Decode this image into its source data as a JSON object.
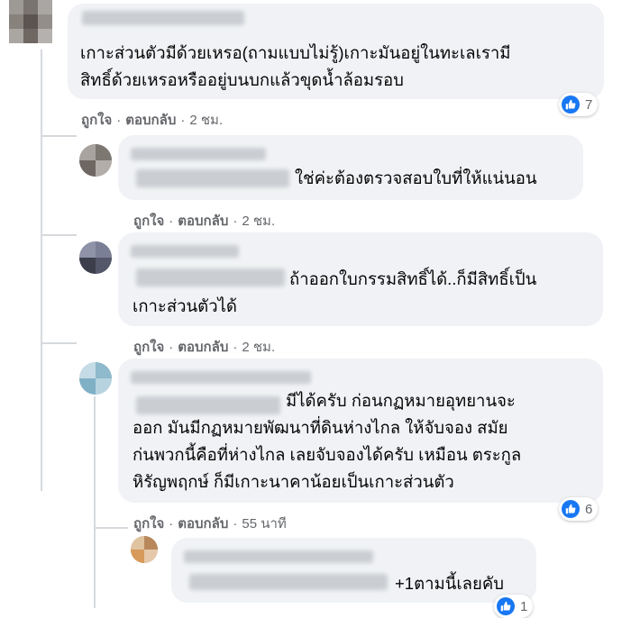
{
  "actions": {
    "like": "ถูกใจ",
    "dot": "·",
    "reply": "ตอบกลับ"
  },
  "comments": [
    {
      "lines": [
        "เกาะส่วนตัวมีด้วยเหรอ(ถามแบบไม่รู้)เกาะมันอยู่ในทะเลเรามี",
        "สิทธิ์ด้วยเหรอหรืออยู่บนบกแล้วขุดน้ำล้อมรอบ"
      ],
      "time": "2 ชม.",
      "reaction_icon": "like-icon",
      "reactions": "7"
    },
    {
      "lines": [
        "ใช่ค่ะต้องตรวจสอบใบที่ให้แน่นอน"
      ],
      "time": "2 ชม."
    },
    {
      "lines": [
        "ถ้าออกใบกรรมสิทธิ์ได้..ก็มีสิทธิ์เป็น",
        "เกาะส่วนตัวได้"
      ],
      "time": "2 ชม."
    },
    {
      "lines": [
        "มีได้ครับ ก่อนกฏหมายอุทยานจะ",
        "ออก มันมีกฏหมายพัฒนาที่ดินห่างไกล ให้จับจอง สมัย",
        "ก่นพวกนี้คือที่ห่างไกล เลยจับจองได้ครับ เหมือน ตระกูล",
        "หิรัญพฤกษ์ ก็มีเกาะนาคาน้อยเป็นเกาะส่วนตัว"
      ],
      "time": "55 นาที",
      "reaction_icon": "like-icon",
      "reactions": "6"
    },
    {
      "lines": [
        "+1ตามนี้เลยคับ"
      ],
      "reaction_icon": "like-icon",
      "reactions": "1"
    }
  ],
  "colors": {
    "bubble": "#f0f2f5",
    "meta": "#65676b",
    "like_blue": "#1877f2"
  }
}
